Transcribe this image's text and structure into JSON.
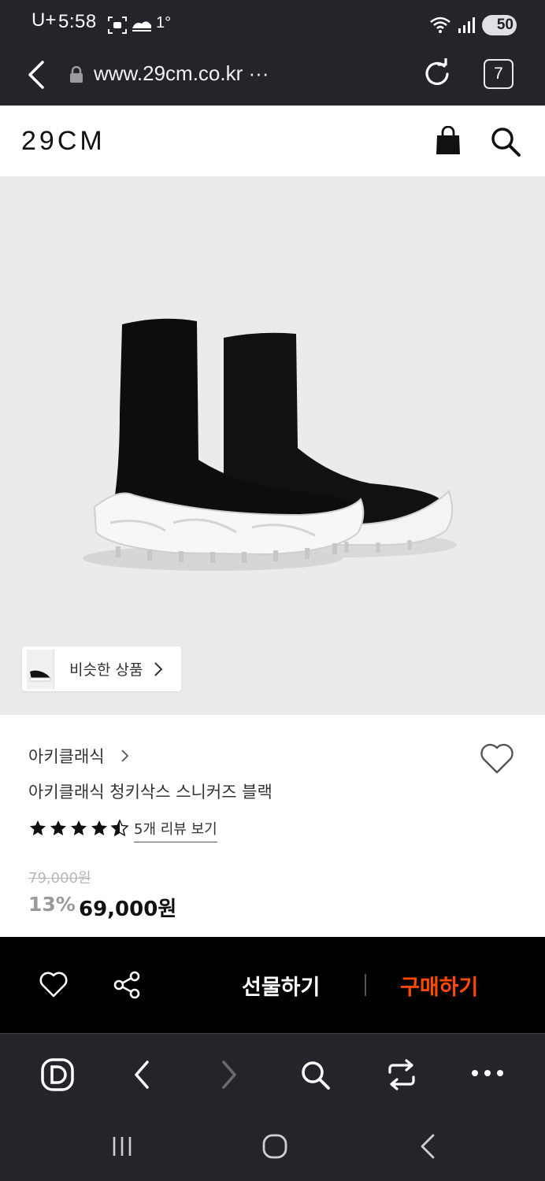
{
  "status_bar": {
    "time": "5:58",
    "carrier": "U+",
    "temperature": "1°",
    "battery": "50"
  },
  "browser": {
    "url": "www.29cm.co.kr ···",
    "tab_count": "7"
  },
  "site": {
    "logo": "29CM"
  },
  "product": {
    "similar_button": "비슷한 상품",
    "brand": "아키클래식",
    "name": "아키클래식 청키삭스 스니커즈 블랙",
    "rating": 4.5,
    "review_link": "5개 리뷰 보기",
    "original_price": "79,000원",
    "discount": "13%",
    "price": "69,000원"
  },
  "action_bar": {
    "gift_label": "선물하기",
    "buy_label": "구매하기",
    "buy_color": "#ff4800"
  },
  "icons": {
    "url_bar": [
      "back-icon",
      "lock-icon",
      "reload-icon"
    ],
    "header": [
      "shopping-bag-icon",
      "search-icon"
    ],
    "toolbar": [
      "d-logo-icon",
      "back-arrow-icon",
      "forward-arrow-icon",
      "search-icon",
      "switch-icon",
      "more-icon"
    ],
    "system_nav": [
      "recents-icon",
      "home-icon",
      "back-icon"
    ]
  }
}
